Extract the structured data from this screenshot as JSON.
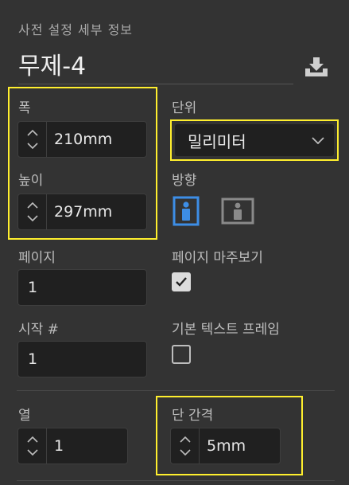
{
  "panel": {
    "section_title": "사전 설정 세부 정보",
    "preset_name": "무제-4"
  },
  "fields": {
    "width_label": "폭",
    "width_value": "210mm",
    "height_label": "높이",
    "height_value": "297mm",
    "units_label": "단위",
    "units_value": "밀리미터",
    "orientation_label": "방향",
    "pages_label": "페이지",
    "pages_value": "1",
    "facing_pages_label": "페이지 마주보기",
    "facing_pages_checked": true,
    "start_label": "시작 #",
    "start_value": "1",
    "primary_text_frame_label": "기본 텍스트 프레임",
    "primary_text_frame_checked": false,
    "columns_label": "열",
    "columns_value": "1",
    "gutter_label": "단 간격",
    "gutter_value": "5mm"
  },
  "colors": {
    "background": "#333333",
    "field_bg": "#202020",
    "highlight": "#ffef2e",
    "accent_blue": "#3d8ee6"
  },
  "icons": {
    "save": "download-preset-icon",
    "portrait": "portrait-orientation-icon",
    "landscape": "landscape-orientation-icon"
  }
}
